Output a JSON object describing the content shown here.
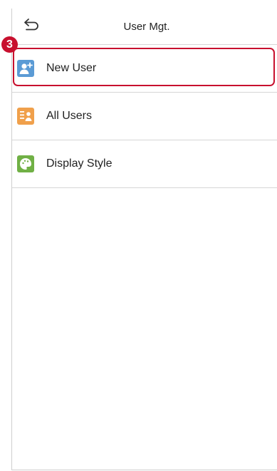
{
  "header": {
    "title": "User Mgt.",
    "back_icon": "back-arrow-icon"
  },
  "menu": {
    "items": [
      {
        "label": "New User",
        "icon": "add-user-icon",
        "icon_color": "#5b9bd5"
      },
      {
        "label": "All Users",
        "icon": "user-list-icon",
        "icon_color": "#f0a04b"
      },
      {
        "label": "Display Style",
        "icon": "palette-icon",
        "icon_color": "#70b045"
      }
    ]
  },
  "annotation": {
    "step_number": "3",
    "highlight_color": "#c8102e"
  }
}
